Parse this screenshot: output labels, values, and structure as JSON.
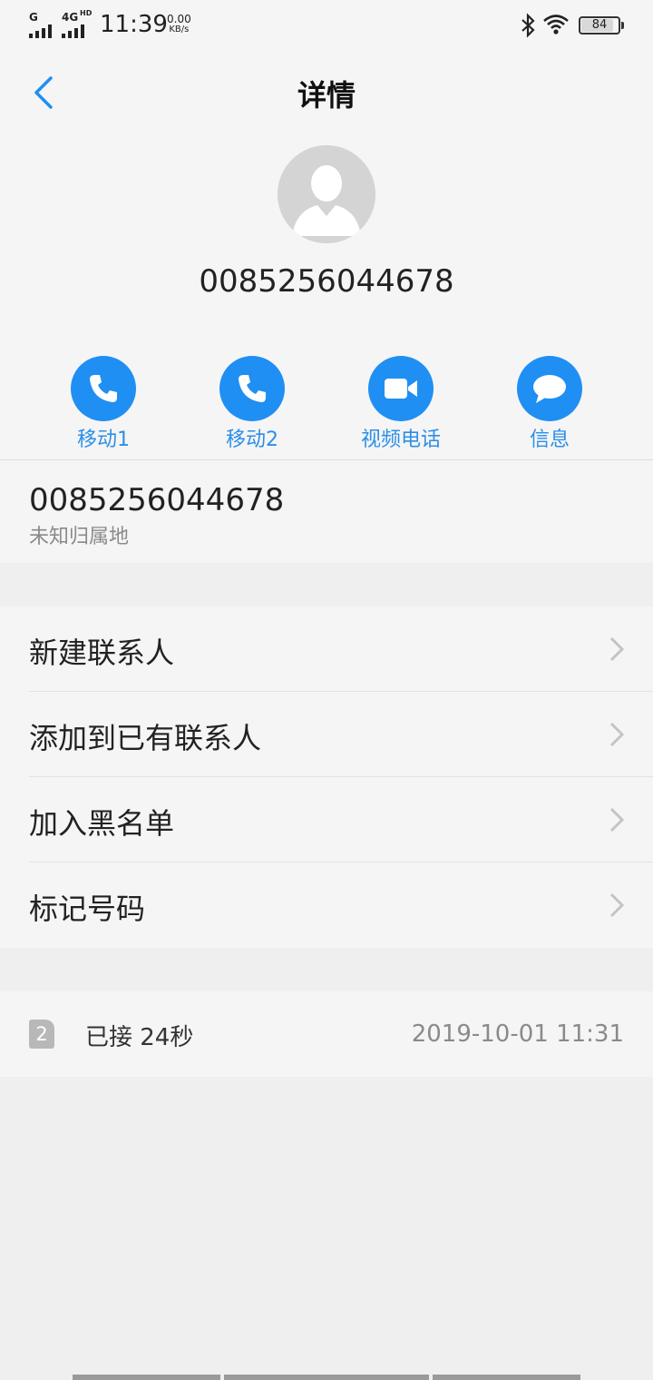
{
  "status_bar": {
    "sim1_net": "G",
    "sim2_net": "4G",
    "sim2_hd": "HD",
    "time": "11:39",
    "speed_value": "0.00",
    "speed_unit": "KB/s",
    "battery": "84"
  },
  "header": {
    "title": "详情"
  },
  "contact": {
    "number": "0085256044678"
  },
  "actions": [
    {
      "label": "移动1",
      "icon": "phone-icon"
    },
    {
      "label": "移动2",
      "icon": "phone-icon"
    },
    {
      "label": "视频电话",
      "icon": "video-camera-icon"
    },
    {
      "label": "信息",
      "icon": "message-bubble-icon"
    }
  ],
  "number_info": {
    "number": "0085256044678",
    "location": "未知归属地"
  },
  "menu": [
    {
      "label": "新建联系人"
    },
    {
      "label": "添加到已有联系人"
    },
    {
      "label": "加入黑名单"
    },
    {
      "label": "标记号码"
    }
  ],
  "history": {
    "sim": "2",
    "status": "已接 24秒",
    "time": "2019-10-01 11:31"
  },
  "colors": {
    "accent": "#1f8ff3",
    "label_blue": "#2c8fe8",
    "background": "#f5f5f5"
  }
}
